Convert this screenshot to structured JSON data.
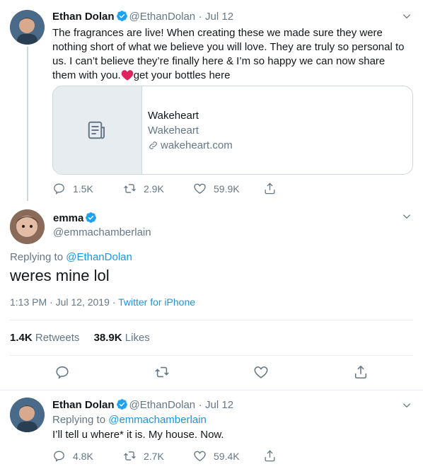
{
  "tweet1": {
    "author_name": "Ethan Dolan",
    "handle": "@EthanDolan",
    "separator": "·",
    "date": "Jul 12",
    "text": "The fragrances are live! When creating these we made sure they were nothing short of what we believe you will love. They are truly so personal to us. I can’t believe they’re finally here & I’m so happy we can now share them with you.",
    "text_tail": "get your bottles here",
    "card": {
      "title": "Wakeheart",
      "description": "Wakeheart",
      "domain": "wakeheart.com"
    },
    "replies": "1.5K",
    "retweets": "2.9K",
    "likes": "59.9K"
  },
  "main_tweet": {
    "author_name": "emma",
    "handle": "@emmachamberlain",
    "replying_prefix": "Replying to",
    "replying_to": "@EthanDolan",
    "text": "weres mine lol",
    "time": "1:13 PM · Jul 12, 2019",
    "separator": "·",
    "source": "Twitter for iPhone",
    "retweet_count": "1.4K",
    "retweet_label": "Retweets",
    "like_count": "38.9K",
    "like_label": "Likes"
  },
  "tweet3": {
    "author_name": "Ethan Dolan",
    "handle": "@EthanDolan",
    "separator": "·",
    "date": "Jul 12",
    "replying_prefix": "Replying to",
    "replying_to": "@emmachamberlain",
    "text": "I’ll tell u where* it is. My house. Now.",
    "replies": "4.8K",
    "retweets": "2.7K",
    "likes": "59.4K"
  },
  "colors": {
    "link": "#1b95e0",
    "muted": "#657786",
    "verified": "#1da1f2",
    "heart": "#e0245e",
    "border": "#e6ecf0"
  },
  "icons": [
    "verified-badge",
    "chevron-down",
    "reply",
    "retweet",
    "like",
    "share",
    "document",
    "link",
    "heart-emoji"
  ]
}
